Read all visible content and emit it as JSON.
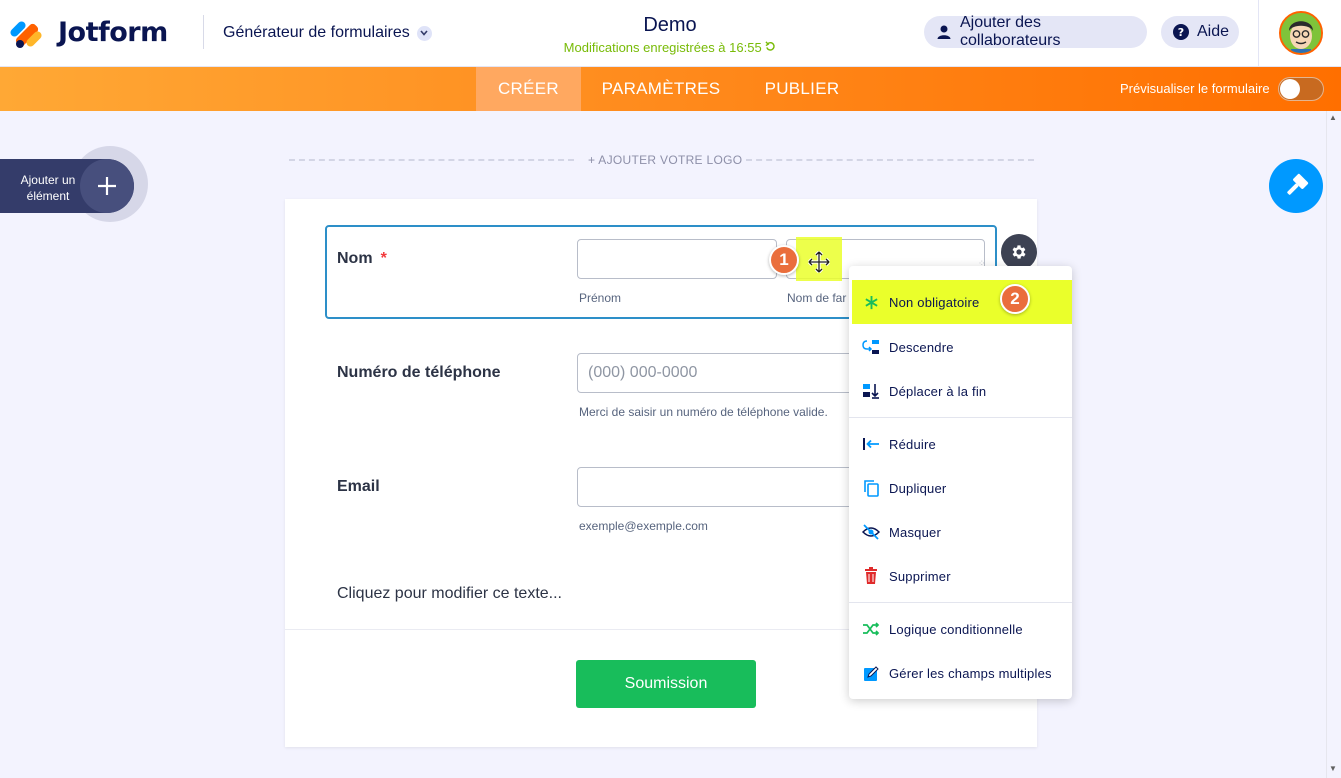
{
  "header": {
    "brand": "Jotform",
    "builder_label": "Générateur de formulaires",
    "form_title": "Demo",
    "saved_status": "Modifications enregistrées à 16:55",
    "add_collaborators": "Ajouter des collaborateurs",
    "help": "Aide"
  },
  "nav": {
    "tabs": [
      {
        "label": "CRÉER",
        "active": true
      },
      {
        "label": "PARAMÈTRES",
        "active": false
      },
      {
        "label": "PUBLIER",
        "active": false
      }
    ],
    "preview_label": "Prévisualiser le formulaire",
    "preview_enabled": true
  },
  "sidebar": {
    "add_element_label": "Ajouter un élément"
  },
  "form": {
    "add_logo": "+ AJOUTER VOTRE LOGO",
    "fields": {
      "name": {
        "label": "Nom",
        "required_mark": "*",
        "first_sublabel": "Prénom",
        "last_sublabel": "Nom de far",
        "first_value": "",
        "last_value": ""
      },
      "phone": {
        "label": "Numéro de téléphone",
        "placeholder": "(000) 000-0000",
        "sublabel": "Merci de saisir un numéro de téléphone valide."
      },
      "email": {
        "label": "Email",
        "value": "",
        "sublabel": "exemple@exemple.com"
      }
    },
    "text_element": "Cliquez pour modifier ce texte...",
    "submit_label": "Soumission"
  },
  "annotations": {
    "step1": "1",
    "step2": "2"
  },
  "context_menu": {
    "items": [
      {
        "label": "Non obligatoire",
        "icon": "asterisk-icon"
      },
      {
        "label": "Descendre",
        "icon": "move-down-icon"
      },
      {
        "label": "Déplacer à la fin",
        "icon": "move-to-end-icon"
      },
      {
        "label": "Réduire",
        "icon": "shrink-icon"
      },
      {
        "label": "Dupliquer",
        "icon": "duplicate-icon"
      },
      {
        "label": "Masquer",
        "icon": "hide-icon"
      },
      {
        "label": "Supprimer",
        "icon": "trash-icon"
      },
      {
        "label": "Logique conditionnelle",
        "icon": "conditional-logic-icon"
      },
      {
        "label": "Gérer les champs multiples",
        "icon": "manage-fields-icon"
      }
    ]
  },
  "colors": {
    "brand_orange": "#ff6100",
    "accent_blue": "#0099ff",
    "submit_green": "#18bd5b",
    "highlight_yellow": "#eaff2b",
    "saved_green": "#78bb07",
    "required_red": "#f23a3c"
  }
}
